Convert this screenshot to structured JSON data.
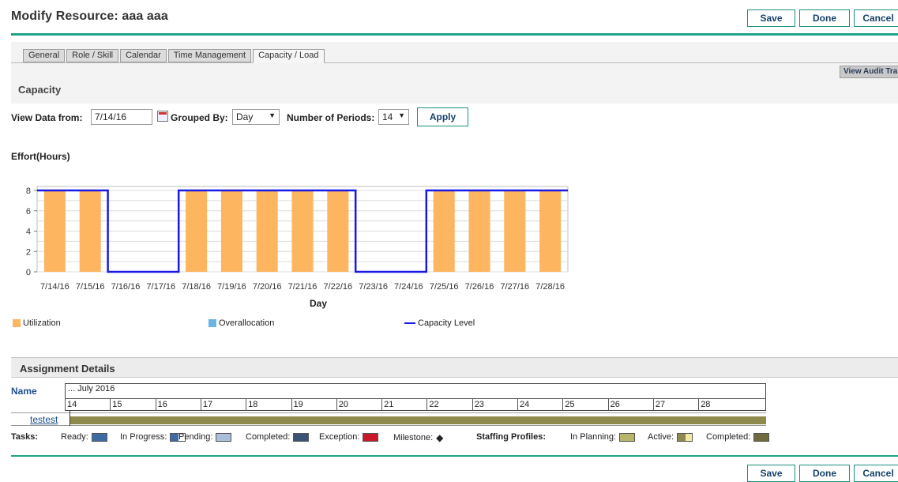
{
  "header": {
    "title": "Modify Resource: aaa aaa",
    "save_label": "Save",
    "done_label": "Done",
    "cancel_label": "Cancel"
  },
  "tabs": [
    "General",
    "Role / Skill",
    "Calendar",
    "Time Management",
    "Capacity / Load"
  ],
  "active_tab": "Capacity / Load",
  "audit_button": "View Audit Tra",
  "section_title": "Capacity",
  "filters": {
    "view_data_from_label": "View Data from:",
    "view_data_from_value": "7/14/16",
    "grouped_by_label": "Grouped By:",
    "grouped_by_value": "Day",
    "periods_label": "Number of Periods:",
    "periods_value": "14",
    "apply_label": "Apply"
  },
  "effort_label": "Effort(Hours)",
  "chart_data": {
    "type": "bar",
    "categories": [
      "7/14/16",
      "7/15/16",
      "7/16/16",
      "7/17/16",
      "7/18/16",
      "7/19/16",
      "7/20/16",
      "7/21/16",
      "7/22/16",
      "7/23/16",
      "7/24/16",
      "7/25/16",
      "7/26/16",
      "7/27/16",
      "7/28/16"
    ],
    "series": [
      {
        "name": "Utilization",
        "values": [
          8,
          8,
          0,
          0,
          8,
          8,
          8,
          8,
          8,
          0,
          0,
          8,
          8,
          8,
          8
        ],
        "color": "#fdb55f"
      },
      {
        "name": "Overallocation",
        "values": [
          0,
          0,
          0,
          0,
          0,
          0,
          0,
          0,
          0,
          0,
          0,
          0,
          0,
          0,
          0
        ],
        "color": "#6ab4e8"
      },
      {
        "name": "Capacity Level",
        "type": "step-line",
        "values": [
          8,
          8,
          0,
          0,
          8,
          8,
          8,
          8,
          8,
          0,
          0,
          8,
          8,
          8,
          8
        ],
        "color": "#1a1ae6"
      }
    ],
    "xlabel": "Day",
    "ylabel": "",
    "ylim": [
      0,
      8
    ],
    "yticks": [
      0,
      2,
      4,
      6,
      8
    ],
    "grid": true,
    "legend": "bottom"
  },
  "assignment": {
    "title": "Assignment Details",
    "name_header": "Name",
    "month_label": "... July 2016",
    "days": [
      "14",
      "15",
      "16",
      "17",
      "18",
      "19",
      "20",
      "21",
      "22",
      "23",
      "24",
      "25",
      "26",
      "27",
      "28"
    ],
    "rows": [
      {
        "name": "testest"
      }
    ]
  },
  "task_legend": {
    "tasks_label": "Tasks:",
    "items": [
      {
        "label": "Ready:",
        "icon": "ready-swatch",
        "color": "#3f6ba3"
      },
      {
        "label": "In Progress:",
        "icon": "in-progress-swatch",
        "color": "#3f6ba3"
      },
      {
        "label": "Pending:",
        "icon": "pending-swatch",
        "color": "#a9bfd9"
      },
      {
        "label": "Completed:",
        "icon": "completed-swatch",
        "color": "#3c5276"
      },
      {
        "label": "Exception:",
        "icon": "exception-swatch",
        "color": "#c8182a"
      },
      {
        "label": "Milestone:",
        "icon": "milestone-diamond-icon",
        "color": "#111111"
      }
    ],
    "staffing_label": "Staffing Profiles:",
    "staffing_items": [
      {
        "label": "In Planning:",
        "icon": "in-planning-swatch",
        "color": "#b7b46c"
      },
      {
        "label": "Active:",
        "icon": "active-swatch",
        "color": "#8e8a4d"
      },
      {
        "label": "Completed:",
        "icon": "staffing-completed-swatch",
        "color": "#6f6b3c"
      }
    ]
  },
  "footer": {
    "save_label": "Save",
    "done_label": "Done",
    "cancel_label": "Cancel"
  }
}
